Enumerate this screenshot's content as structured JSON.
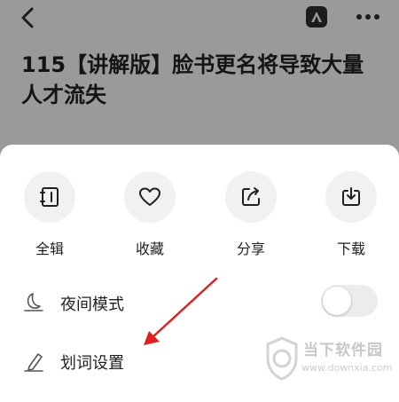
{
  "header": {
    "back_icon": "chevron-left-icon",
    "badge_letter": "A",
    "more_icon": "more-dots-icon",
    "title": "115【讲解版】脸书更名将导致大量人才流失"
  },
  "actions": [
    {
      "label": "全辑",
      "icon": "album-icon"
    },
    {
      "label": "收藏",
      "icon": "heart-icon"
    },
    {
      "label": "分享",
      "icon": "share-icon"
    },
    {
      "label": "下载",
      "icon": "download-icon"
    }
  ],
  "settings": {
    "night_mode": {
      "label": "夜间模式",
      "icon": "moon-icon",
      "enabled": false
    },
    "word_select": {
      "label": "划词设置",
      "icon": "pen-icon"
    }
  },
  "watermark": {
    "brand": "当下软件园",
    "url": "www.downxia.com"
  },
  "colors": {
    "overlay": "#9a9a9a",
    "annotation_arrow": "#e02020",
    "icon_bg": "#f1f1f1"
  }
}
